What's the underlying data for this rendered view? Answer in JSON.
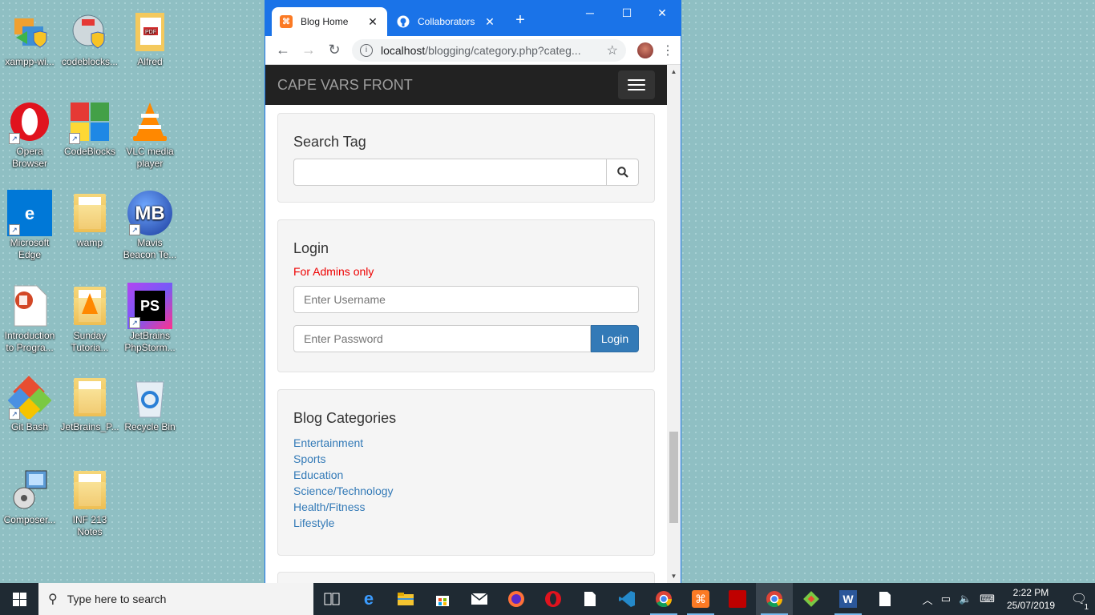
{
  "desktop": {
    "icons": [
      {
        "label": "xampp-wi...",
        "icon": "xampp-installer-icon"
      },
      {
        "label": "codeblocks...",
        "icon": "codeblocks-installer-icon"
      },
      {
        "label": "Alfred",
        "icon": "pdf-folder-icon"
      },
      {
        "label": "Opera Browser",
        "icon": "opera-icon"
      },
      {
        "label": "CodeBlocks",
        "icon": "codeblocks-icon"
      },
      {
        "label": "VLC media player",
        "icon": "vlc-icon"
      },
      {
        "label": "Microsoft Edge",
        "icon": "edge-icon"
      },
      {
        "label": "wamp",
        "icon": "folder-icon"
      },
      {
        "label": "Mavis Beacon Te...",
        "icon": "mavis-beacon-icon"
      },
      {
        "label": "Introduction to Progra...",
        "icon": "powerpoint-file-icon"
      },
      {
        "label": "Sunday Tutoria...",
        "icon": "vlc-folder-icon"
      },
      {
        "label": "JetBrains PhpStorm...",
        "icon": "phpstorm-icon"
      },
      {
        "label": "Git Bash",
        "icon": "git-bash-icon"
      },
      {
        "label": "JetBrains_P...",
        "icon": "folder-icon"
      },
      {
        "label": "Recycle Bin",
        "icon": "recycle-bin-icon"
      },
      {
        "label": "Composer...",
        "icon": "composer-setup-icon"
      },
      {
        "label": "INF 213 Notes",
        "icon": "folder-icon"
      }
    ],
    "icon_text": {
      "mb": "MB",
      "ps": "PS",
      "pdf": "PDF",
      "edge": "e"
    }
  },
  "browser": {
    "tabs": [
      {
        "title": "Blog Home",
        "favicon": "xampp-favicon-icon",
        "active": true
      },
      {
        "title": "Collaborators",
        "favicon": "github-icon",
        "active": false
      }
    ],
    "url_host": "localhost",
    "url_path": "/blogging/category.php?categ..."
  },
  "page": {
    "brand": "CAPE VARS FRONT",
    "search": {
      "heading": "Search Tag",
      "value": ""
    },
    "login": {
      "heading": "Login",
      "note": "For Admins only",
      "username_placeholder": "Enter Username",
      "password_placeholder": "Enter Password",
      "button": "Login"
    },
    "categories": {
      "heading": "Blog Categories",
      "items": [
        "Entertainment",
        "Sports",
        "Education",
        "Science/Technology",
        "Health/Fitness",
        "Lifestyle"
      ]
    }
  },
  "taskbar": {
    "search_placeholder": "Type here to search",
    "time": "2:22 PM",
    "date": "25/07/2019",
    "notification_count": "1"
  },
  "colors": {
    "chrome_accent": "#1a73e8",
    "navbar_bg": "#222222",
    "link": "#337ab7",
    "alert_red": "#e00000"
  }
}
